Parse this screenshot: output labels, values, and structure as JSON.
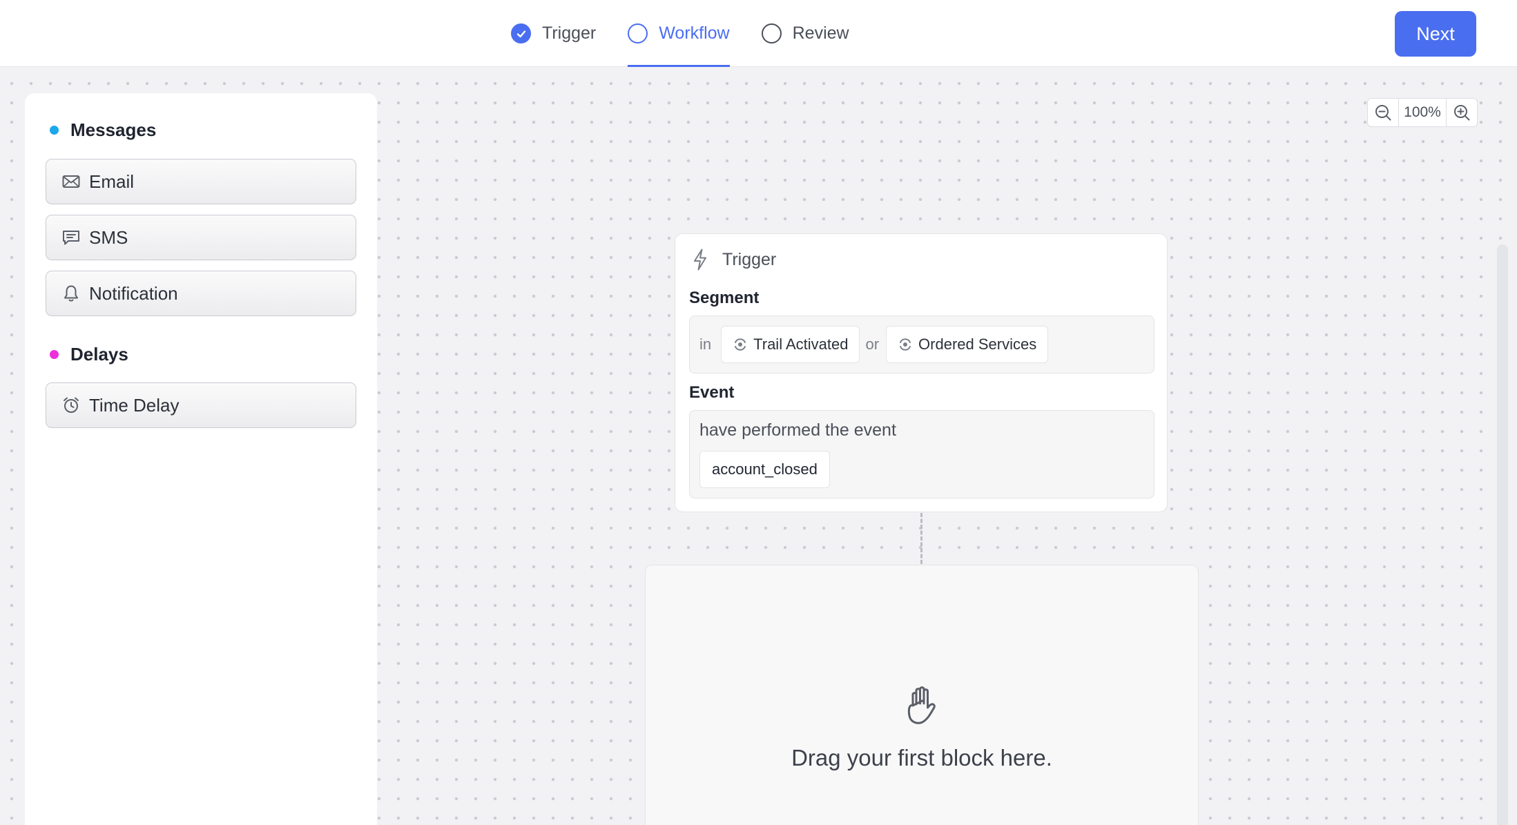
{
  "stepper": {
    "steps": [
      {
        "label": "Trigger",
        "state": "completed"
      },
      {
        "label": "Workflow",
        "state": "active"
      },
      {
        "label": "Review",
        "state": "pending"
      }
    ]
  },
  "header": {
    "next_label": "Next"
  },
  "palette": {
    "messages": {
      "title": "Messages",
      "dot_color": "#1aa7ec",
      "items": [
        {
          "label": "Email",
          "icon": "mail-icon"
        },
        {
          "label": "SMS",
          "icon": "chat-icon"
        },
        {
          "label": "Notification",
          "icon": "bell-icon"
        }
      ]
    },
    "delays": {
      "title": "Delays",
      "dot_color": "#ee2ddc",
      "items": [
        {
          "label": "Time Delay",
          "icon": "alarm-clock-icon"
        }
      ]
    }
  },
  "zoom": {
    "value": "100%"
  },
  "trigger_card": {
    "title": "Trigger",
    "segment_label": "Segment",
    "segment_prefix": "in",
    "segments": [
      "Trail Activated",
      "Ordered Services"
    ],
    "segment_joiner": "or",
    "event_label": "Event",
    "event_text": "have performed the event",
    "event_name": "account_closed"
  },
  "dropzone": {
    "text": "Drag your first block here.",
    "icon": "hand-icon"
  },
  "colors": {
    "accent": "#4a6ef0",
    "canvas": "#f2f2f4"
  }
}
